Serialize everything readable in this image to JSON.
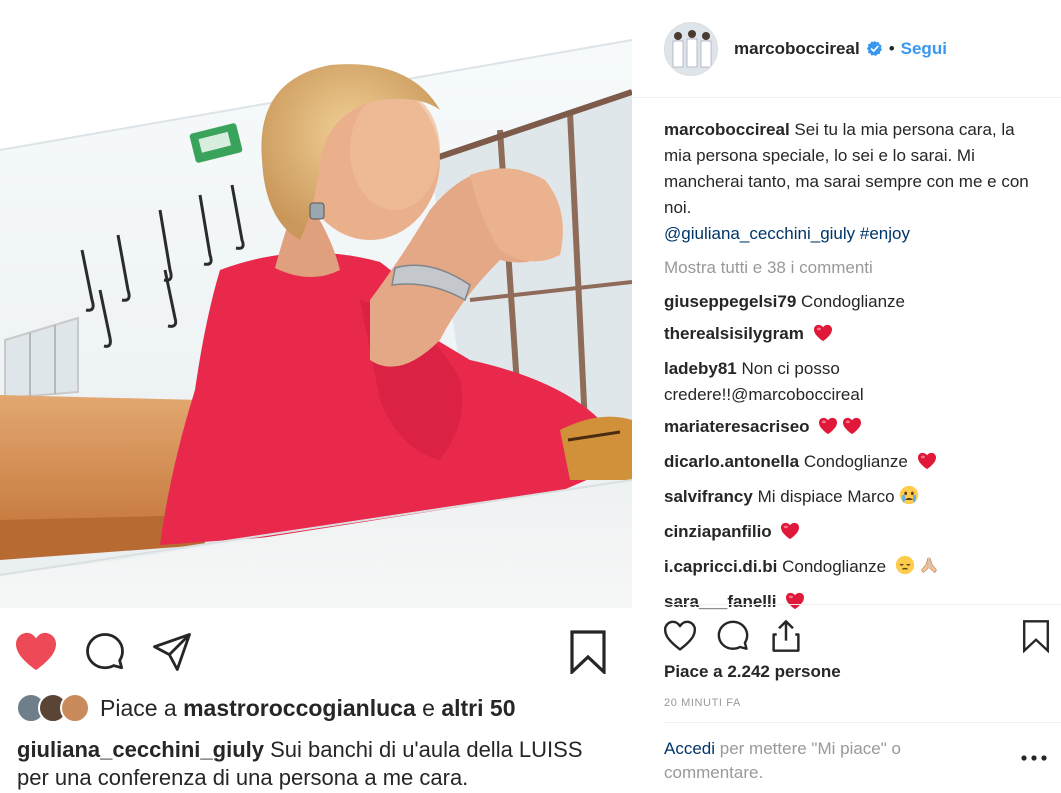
{
  "left": {
    "likes_prefix": "Piace a",
    "likes_user": "mastroroccogianluca",
    "likes_mid": "e",
    "likes_others": "altri 50",
    "caption_user": "giuliana_cecchini_giuly",
    "caption_text": "Sui banchi di u'aula della LUISS per una conferenza di una persona a me cara."
  },
  "post": {
    "username": "marcoboccireal",
    "dot": "•",
    "follow": "Segui",
    "caption_user": "marcoboccireal",
    "caption_text": "Sei tu la mia persona cara, la mia persona speciale, lo sei e lo sarai. Mi mancherai tanto, ma sarai sempre con me e con noi.",
    "tags": "@giuliana_cecchini_giuly #enjoy",
    "show_all": "Mostra tutti e 38 i commenti",
    "likes": "Piace a 2.242 persone",
    "time": "20 MINUTI FA",
    "login_link": "Accedi",
    "login_text": "per mettere \"Mi piace\" o commentare."
  },
  "comments": [
    {
      "user": "giuseppegelsi79",
      "text": "Condoglianze",
      "emoji": ""
    },
    {
      "user": "therealsisilygram",
      "text": "",
      "emoji": "heart"
    },
    {
      "user": "ladeby81",
      "text": "Non ci posso credere!!@marcoboccireal",
      "emoji": ""
    },
    {
      "user": "mariateresacriseo",
      "text": "",
      "emoji": "heart-heart"
    },
    {
      "user": "dicarlo.antonella",
      "text": "Condoglianze",
      "emoji": "heart"
    },
    {
      "user": "salvifrancy",
      "text": "Mi dispiace Marco",
      "emoji": "crying-face"
    },
    {
      "user": "cinziapanfilio",
      "text": "",
      "emoji": "heart"
    },
    {
      "user": "i.capricci.di.bi",
      "text": "Condoglianze",
      "emoji": "pensive-face-pray"
    },
    {
      "user": "sara___fanelli",
      "text": "",
      "emoji": "heart"
    }
  ],
  "colors": {
    "accent": "#3897f0",
    "link": "#003569",
    "like_red": "#ed4956",
    "muted": "#999999"
  }
}
